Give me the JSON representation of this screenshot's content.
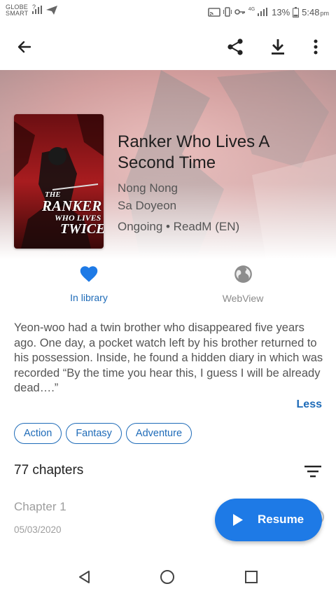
{
  "status_bar": {
    "carrier_line1": "GLOBE",
    "carrier_line2": "SMART",
    "carrier_flag": "?",
    "network": "4G",
    "battery": "13%",
    "time": "5:48",
    "ampm": "pm",
    "icons": [
      "signal-icon",
      "send-icon",
      "cast-icon",
      "vibrate-icon",
      "key-icon",
      "signal-icon",
      "battery-icon"
    ]
  },
  "app_bar": {
    "icons": [
      "back-arrow-icon",
      "share-icon",
      "download-icon",
      "more-vert-icon"
    ]
  },
  "manga": {
    "title_line1": "Ranker Who Lives A",
    "title_line2": "Second Time",
    "author": "Nong Nong",
    "artist": "Sa Doyeon",
    "status_source": "Ongoing • ReadM (EN)",
    "cover_text": [
      "THE",
      "RANKER",
      "WHO LIVES",
      "TWICE"
    ]
  },
  "actions": {
    "library_label": "In library",
    "webview_label": "WebView"
  },
  "description": {
    "text": "Yeon-woo had a twin brother who disappeared five years ago. One day, a pocket watch left by his brother returned to his possession. Inside, he found a hidden diary in which was recorded “By the time you hear this, I guess I will be already dead….”",
    "toggle_label": "Less"
  },
  "genres": [
    "Action",
    "Fantasy",
    "Adventure"
  ],
  "chapters": {
    "count_label": "77 chapters",
    "items": [
      {
        "name": "Chapter 1",
        "date": "05/03/2020"
      }
    ]
  },
  "fab": {
    "label": "Resume"
  },
  "colors": {
    "accent": "#1e6bb8",
    "fab": "#1e7ae6",
    "library_heart": "#1e7ae6"
  }
}
